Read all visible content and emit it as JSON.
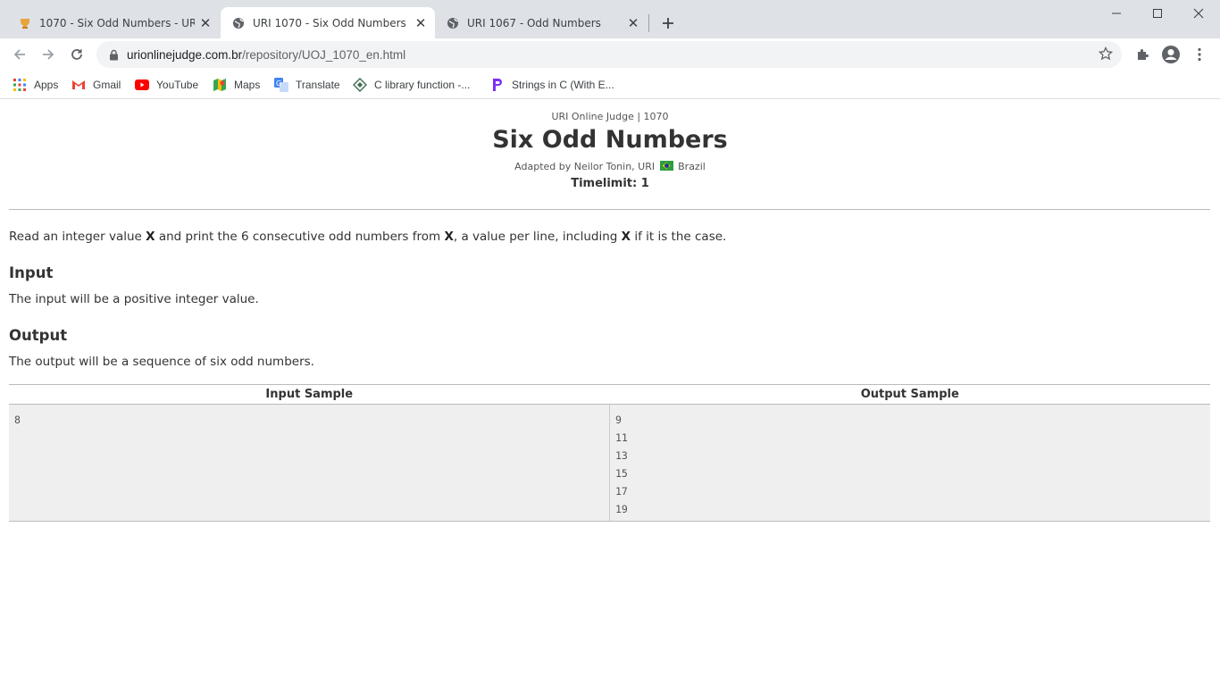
{
  "tabs": [
    {
      "title": "1070 - Six Odd Numbers - URI O",
      "favicon": "uri-trophy-icon",
      "active": false
    },
    {
      "title": "URI 1070 - Six Odd Numbers",
      "favicon": "globe-icon",
      "active": true
    },
    {
      "title": "URI 1067 - Odd Numbers",
      "favicon": "globe-icon",
      "active": false
    }
  ],
  "toolbar": {
    "url_host": "urionlinejudge.com.br",
    "url_path": "/repository/UOJ_1070_en.html"
  },
  "bookmarks": [
    {
      "label": "Apps",
      "icon": "apps-grid-icon"
    },
    {
      "label": "Gmail",
      "icon": "gmail-icon"
    },
    {
      "label": "YouTube",
      "icon": "youtube-icon"
    },
    {
      "label": "Maps",
      "icon": "maps-icon"
    },
    {
      "label": "Translate",
      "icon": "translate-icon"
    },
    {
      "label": "C library function -...",
      "icon": "diamond-icon"
    },
    {
      "label": "Strings in C (With E...",
      "icon": "programiz-icon"
    }
  ],
  "problem": {
    "judge_line": "URI Online Judge | 1070",
    "title": "Six Odd Numbers",
    "adapted_prefix": "Adapted by Neilor Tonin, URI",
    "adapted_country": "Brazil",
    "timelimit": "Timelimit: 1",
    "description": {
      "p1": "Read an integer value ",
      "x1": "X",
      "p2": " and print the 6 consecutive odd numbers from ",
      "x2": "X",
      "p3": ", a value per line, including ",
      "x3": "X",
      "p4": " if it is the case."
    },
    "input_heading": "Input",
    "input_text": "The input will be a positive integer value.",
    "output_heading": "Output",
    "output_text": "The output will be a sequence of six odd numbers."
  },
  "sample": {
    "input_header": "Input Sample",
    "output_header": "Output Sample",
    "input_lines": [
      "8"
    ],
    "output_lines": [
      "9",
      "11",
      "13",
      "15",
      "17",
      "19"
    ]
  }
}
